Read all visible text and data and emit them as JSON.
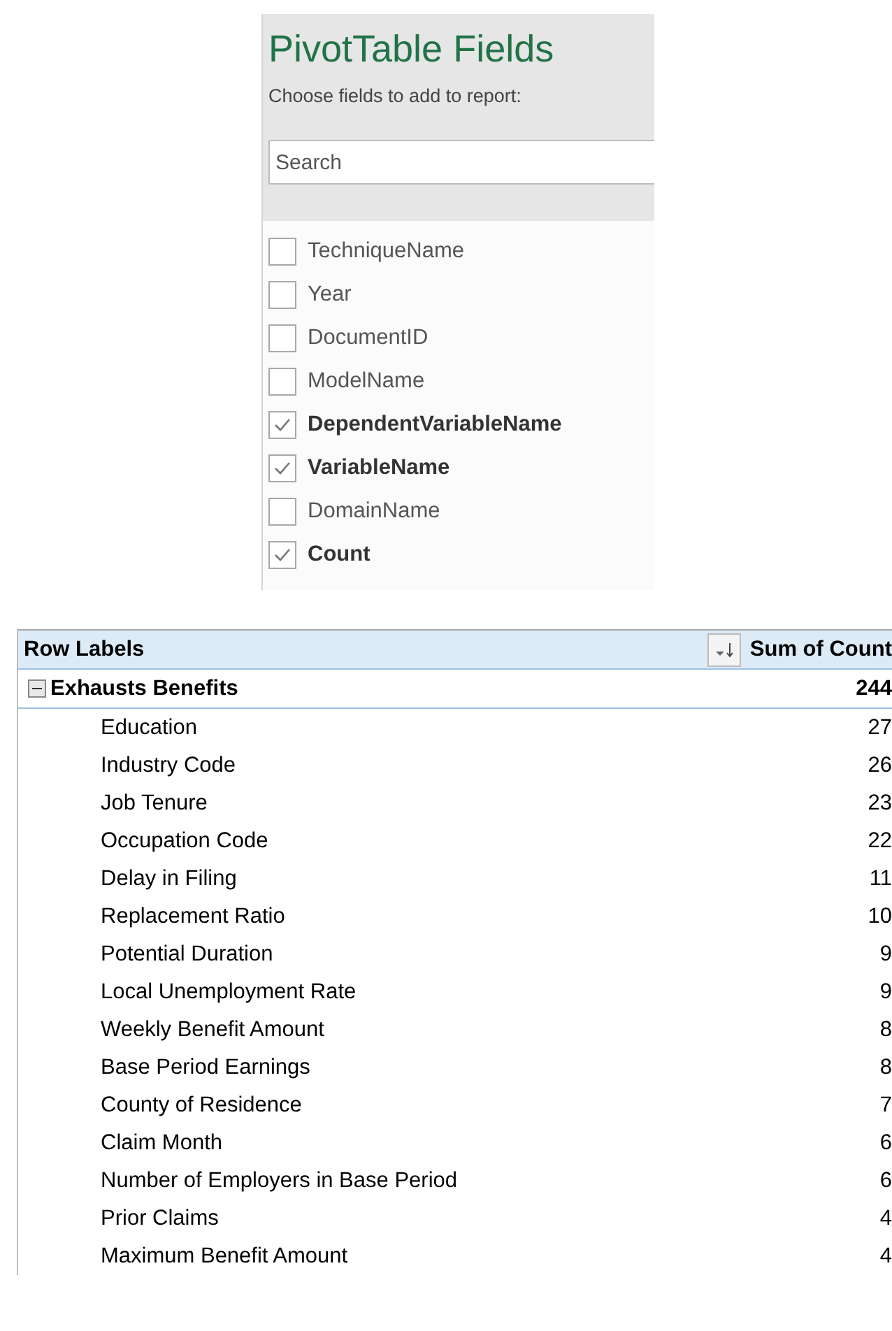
{
  "panel": {
    "title": "PivotTable Fields",
    "subtitle": "Choose fields to add to report:",
    "search": {
      "placeholder": "Search"
    },
    "fields": [
      {
        "label": "TechniqueName",
        "checked": false
      },
      {
        "label": "Year",
        "checked": false
      },
      {
        "label": "DocumentID",
        "checked": false
      },
      {
        "label": "ModelName",
        "checked": false
      },
      {
        "label": "DependentVariableName",
        "checked": true
      },
      {
        "label": "VariableName",
        "checked": true
      },
      {
        "label": "DomainName",
        "checked": false
      },
      {
        "label": "Count",
        "checked": true
      }
    ]
  },
  "table": {
    "columns": [
      "Row Labels",
      "Sum of Count"
    ],
    "groups": [
      {
        "label": "Exhausts Benefits",
        "total": "244",
        "expanded": true,
        "children": [
          {
            "label": "Education",
            "value": "27"
          },
          {
            "label": "Industry Code",
            "value": "26"
          },
          {
            "label": "Job Tenure",
            "value": "23"
          },
          {
            "label": "Occupation Code",
            "value": "22"
          },
          {
            "label": "Delay in Filing",
            "value": "11"
          },
          {
            "label": "Replacement Ratio",
            "value": "10"
          },
          {
            "label": "Potential Duration",
            "value": "9"
          },
          {
            "label": "Local Unemployment Rate",
            "value": "9"
          },
          {
            "label": "Weekly Benefit Amount",
            "value": "8"
          },
          {
            "label": "Base Period Earnings",
            "value": "8"
          },
          {
            "label": "County of Residence",
            "value": "7"
          },
          {
            "label": "Claim Month",
            "value": "6"
          },
          {
            "label": "Number of Employers in Base Period",
            "value": "6"
          },
          {
            "label": "Prior Claims",
            "value": "4"
          },
          {
            "label": "Maximum Benefit Amount",
            "value": "4"
          }
        ]
      }
    ]
  }
}
